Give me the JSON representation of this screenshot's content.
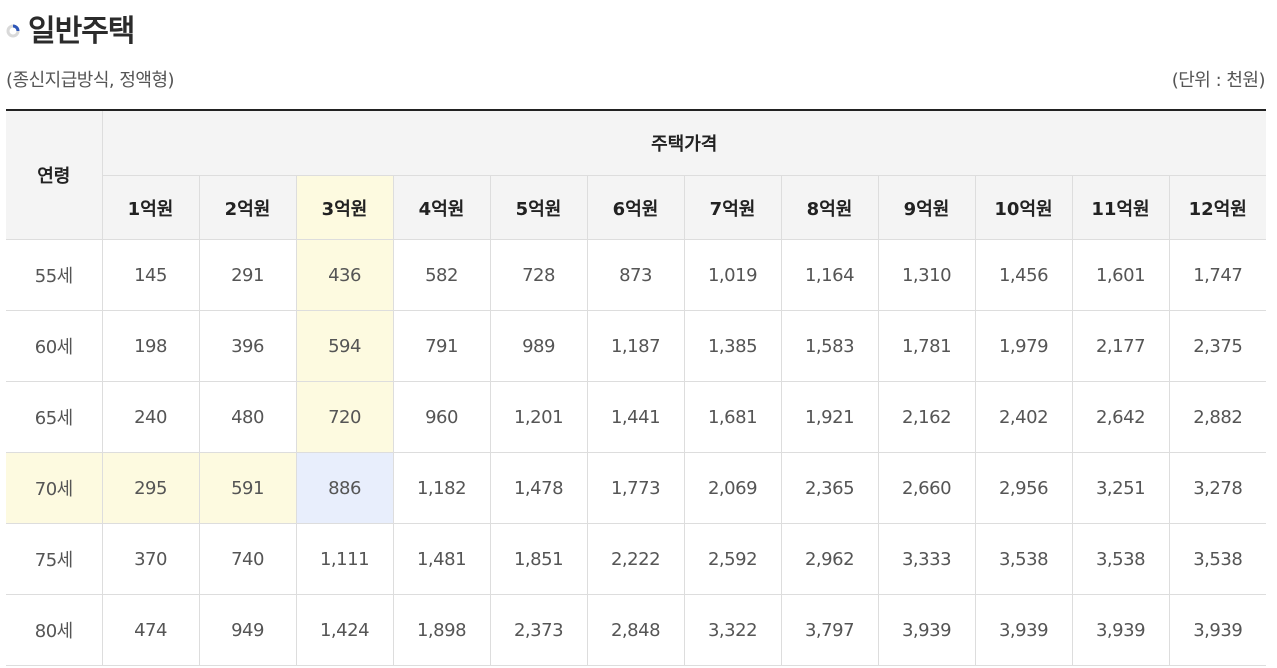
{
  "title": "일반주택",
  "subtitle_left": "(종신지급방식, 정액형)",
  "subtitle_right": "(단위 : 천원)",
  "header": {
    "age_label": "연령",
    "price_label": "주택가격",
    "columns": [
      "1억원",
      "2억원",
      "3억원",
      "4억원",
      "5억원",
      "6억원",
      "7억원",
      "8억원",
      "9억원",
      "10억원",
      "11억원",
      "12억원"
    ]
  },
  "rows": [
    {
      "age": "55세",
      "values": [
        "145",
        "291",
        "436",
        "582",
        "728",
        "873",
        "1,019",
        "1,164",
        "1,310",
        "1,456",
        "1,601",
        "1,747"
      ]
    },
    {
      "age": "60세",
      "values": [
        "198",
        "396",
        "594",
        "791",
        "989",
        "1,187",
        "1,385",
        "1,583",
        "1,781",
        "1,979",
        "2,177",
        "2,375"
      ]
    },
    {
      "age": "65세",
      "values": [
        "240",
        "480",
        "720",
        "960",
        "1,201",
        "1,441",
        "1,681",
        "1,921",
        "2,162",
        "2,402",
        "2,642",
        "2,882"
      ]
    },
    {
      "age": "70세",
      "values": [
        "295",
        "591",
        "886",
        "1,182",
        "1,478",
        "1,773",
        "2,069",
        "2,365",
        "2,660",
        "2,956",
        "3,251",
        "3,278"
      ]
    },
    {
      "age": "75세",
      "values": [
        "370",
        "740",
        "1,111",
        "1,481",
        "1,851",
        "2,222",
        "2,592",
        "2,962",
        "3,333",
        "3,538",
        "3,538",
        "3,538"
      ]
    },
    {
      "age": "80세",
      "values": [
        "474",
        "949",
        "1,424",
        "1,898",
        "2,373",
        "2,848",
        "3,322",
        "3,797",
        "3,939",
        "3,939",
        "3,939",
        "3,939"
      ]
    }
  ],
  "highlight": {
    "column": "3억원",
    "row": "70세",
    "color_yellow": "#fdfae0",
    "color_blue": "#e8eefc"
  }
}
